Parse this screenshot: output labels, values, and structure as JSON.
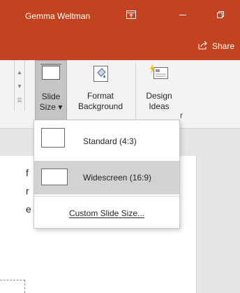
{
  "titlebar": {
    "user_name": "Gemma Weltman",
    "icons": [
      "ribbon-display-icon",
      "minimize-icon",
      "restore-icon"
    ]
  },
  "ribbon_tabs": {
    "share_label": "Share"
  },
  "ribbon": {
    "slide_size": {
      "line1": "Slide",
      "line2": "Size ▾"
    },
    "format_background": {
      "line1": "Format",
      "line2": "Background"
    },
    "design_ideas": {
      "line1": "Design",
      "line2": "Ideas"
    },
    "group_label_fragment": "r"
  },
  "slide_size_menu": {
    "items": [
      {
        "label": "Standard (4:3)",
        "selected": false
      },
      {
        "label": "Widescreen (16:9)",
        "selected": true
      }
    ],
    "custom": "Custom Slide Size..."
  },
  "slide_text_fragments": [
    "f",
    "r",
    "e"
  ],
  "colors": {
    "accent": "#c2431f",
    "ribbon_bg": "#f3f3f3",
    "selected_bg": "#d2d2d2"
  }
}
